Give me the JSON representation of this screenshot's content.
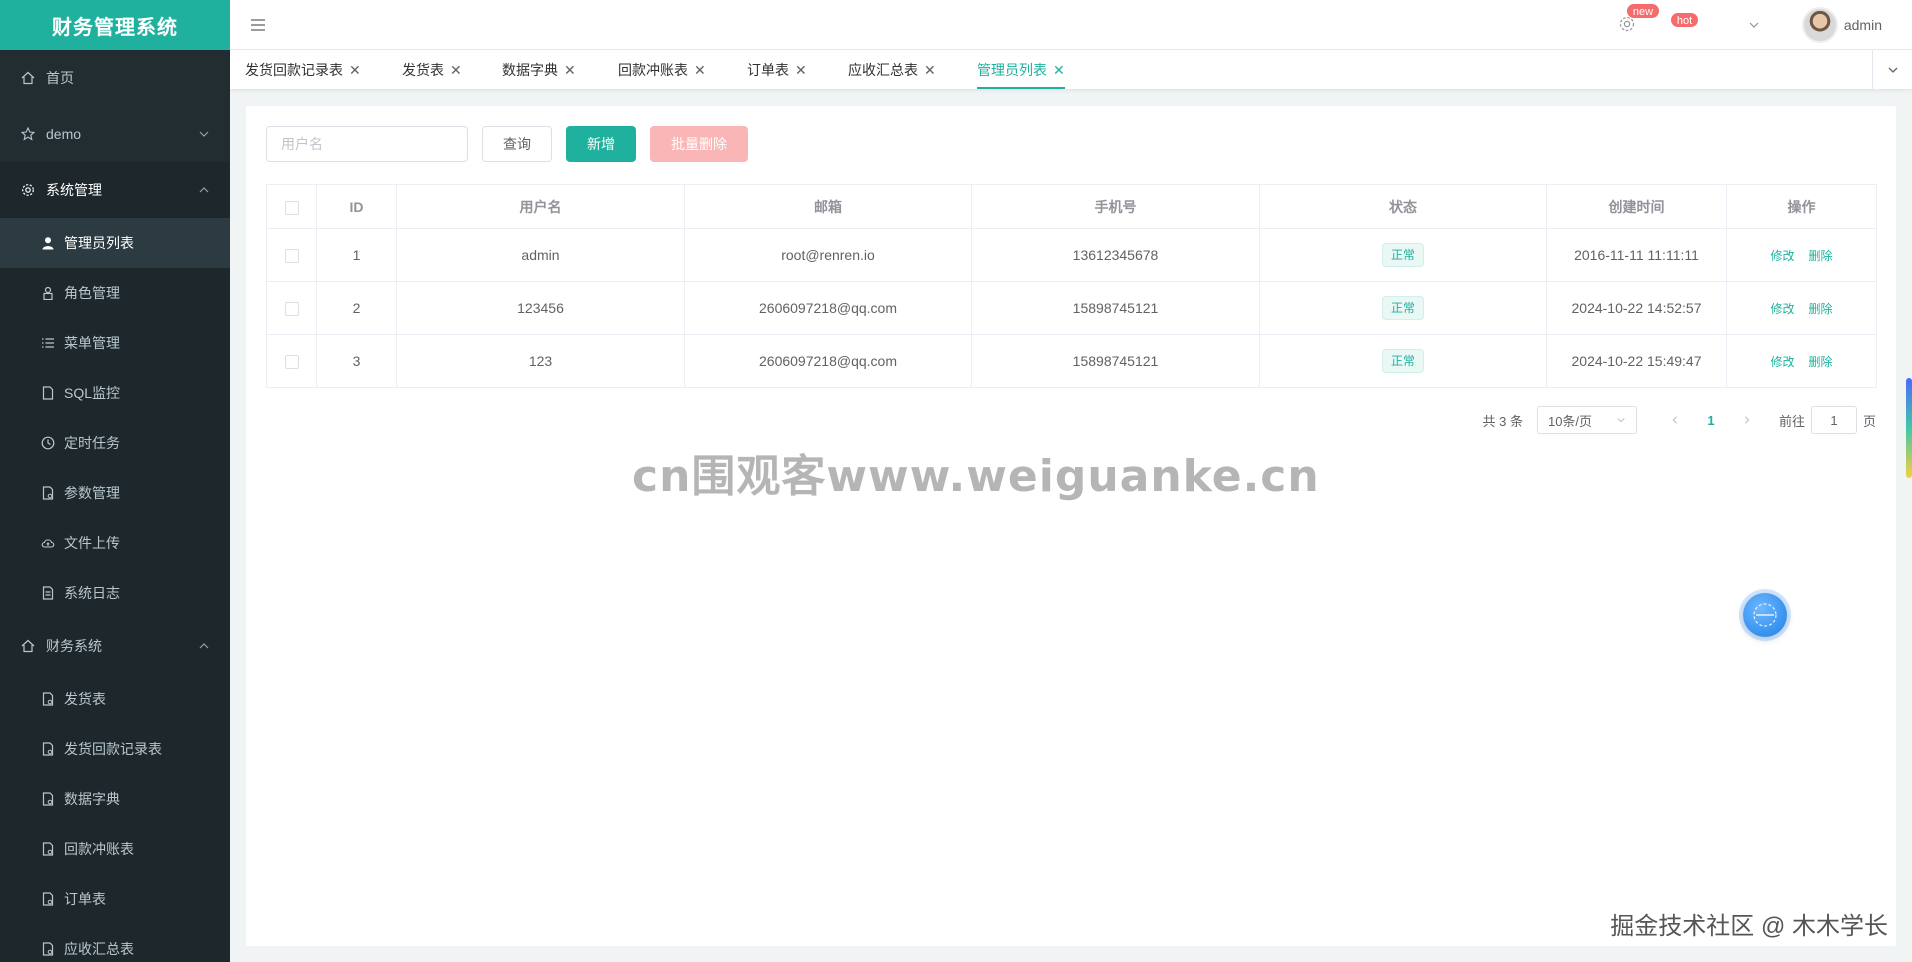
{
  "app": {
    "title": "财务管理系统",
    "user": "admin"
  },
  "colors": {
    "accent": "#1fb19e",
    "sidebar_bg": "#222d32",
    "danger_light": "#fab6b6",
    "badge": "#f56c6c"
  },
  "sidebar": {
    "home": "首页",
    "demo": "demo",
    "system": "系统管理",
    "system_items": [
      "管理员列表",
      "角色管理",
      "菜单管理",
      "SQL监控",
      "定时任务",
      "参数管理",
      "文件上传",
      "系统日志"
    ],
    "finance": "财务系统",
    "finance_items": [
      "发货表",
      "发货回款记录表",
      "数据字典",
      "回款冲账表",
      "订单表",
      "应收汇总表"
    ]
  },
  "topbar": {
    "badge_new": "new",
    "badge_hot": "hot"
  },
  "tabs": [
    "发货回款记录表",
    "发货表",
    "数据字典",
    "回款冲账表",
    "订单表",
    "应收汇总表",
    "管理员列表"
  ],
  "toolbar": {
    "search_placeholder": "用户名",
    "query": "查询",
    "add": "新增",
    "batch_delete": "批量删除"
  },
  "table": {
    "columns": [
      "ID",
      "用户名",
      "邮箱",
      "手机号",
      "状态",
      "创建时间",
      "操作"
    ],
    "rows": [
      {
        "id": "1",
        "username": "admin",
        "email": "root@renren.io",
        "mobile": "13612345678",
        "status": "正常",
        "created": "2016-11-11 11:11:11"
      },
      {
        "id": "2",
        "username": "123456",
        "email": "2606097218@qq.com",
        "mobile": "15898745121",
        "status": "正常",
        "created": "2024-10-22 14:52:57"
      },
      {
        "id": "3",
        "username": "123",
        "email": "2606097218@qq.com",
        "mobile": "15898745121",
        "status": "正常",
        "created": "2024-10-22 15:49:47"
      }
    ],
    "edit": "修改",
    "delete": "删除"
  },
  "pagination": {
    "total": "共 3 条",
    "page_size": "10条/页",
    "current": "1",
    "goto_prefix": "前往",
    "goto_value": "1",
    "goto_suffix": "页"
  },
  "watermarks": {
    "center": "cn围观客www.weiguanke.cn",
    "bottom": "掘金技术社区 @ 木木学长"
  }
}
